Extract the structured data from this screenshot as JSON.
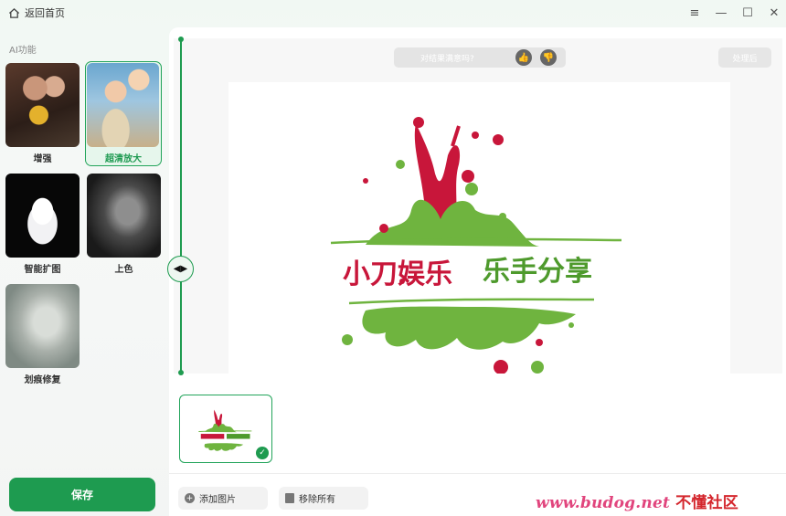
{
  "titlebar": {
    "back_label": "返回首页",
    "icons": [
      "home-icon",
      "menu-icon",
      "minimize-icon",
      "maximize-icon",
      "close-icon"
    ]
  },
  "sidebar": {
    "section_label": "AI功能",
    "cards": [
      {
        "label": "增强",
        "active": false
      },
      {
        "label": "超清放大",
        "active": true
      },
      {
        "label": "智能扩图",
        "active": false
      },
      {
        "label": "上色",
        "active": false
      },
      {
        "label": "划痕修复",
        "active": false
      }
    ],
    "save_label": "保存"
  },
  "preview": {
    "feedback_text": "对结果满意吗?",
    "after_label": "处理后",
    "logo_text_left": "小刀娱乐",
    "logo_text_right": "乐手分享"
  },
  "thumbnails": [
    {
      "selected": true
    }
  ],
  "toolbar": {
    "add_label": "添加图片",
    "remove_label": "移除所有"
  },
  "watermark": {
    "url": "www.budog.net",
    "cn": "不懂社区"
  },
  "colors": {
    "accent": "#1f9b50",
    "logo_green": "#6fb43f",
    "logo_red": "#c8163a"
  }
}
